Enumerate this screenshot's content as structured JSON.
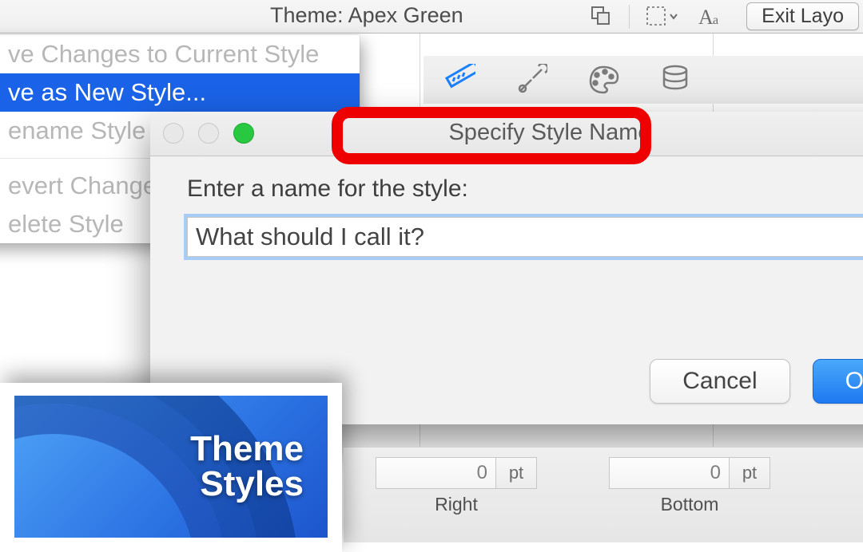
{
  "toolbar": {
    "theme_label_prefix": "Theme:",
    "theme_name": "Apex Green",
    "exit_button": "Exit Layo"
  },
  "menu": {
    "item_save_current": "ve Changes to Current Style",
    "item_save_new": "ve as New Style...",
    "item_rename": "ename Style",
    "item_revert": "evert Changes to Style",
    "item_delete": "elete Style"
  },
  "dialog": {
    "title": "Specify Style Name",
    "prompt": "Enter a name for the style:",
    "input_value": "What should I call it?",
    "cancel": "Cancel",
    "ok": "OK"
  },
  "inspector": {
    "right_value": "0",
    "right_unit": "pt",
    "right_label": "Right",
    "bottom_value": "0",
    "bottom_unit": "pt",
    "bottom_label": "Bottom"
  },
  "card": {
    "line1": "Theme",
    "line2": "Styles"
  }
}
